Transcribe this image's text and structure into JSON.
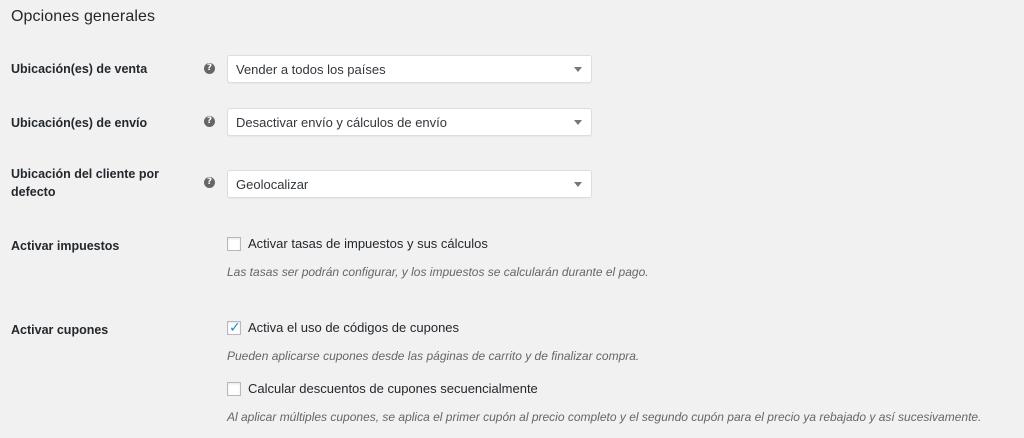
{
  "section": {
    "title": "Opciones generales"
  },
  "selling_locations": {
    "label": "Ubicación(es) de venta",
    "value": "Vender a todos los países"
  },
  "shipping_locations": {
    "label": "Ubicación(es) de envío",
    "value": "Desactivar envío y cálculos de envío"
  },
  "default_customer_location": {
    "label": "Ubicación del cliente por defecto",
    "value": "Geolocalizar"
  },
  "enable_taxes": {
    "label": "Activar impuestos",
    "checkbox_label": "Activar tasas de impuestos y sus cálculos",
    "checked": false,
    "description": "Las tasas ser podrán configurar, y los impuestos se calcularán durante el pago."
  },
  "enable_coupons": {
    "label": "Activar cupones",
    "checkbox_label": "Activa el uso de códigos de cupones",
    "checked": true,
    "description": "Pueden aplicarse cupones desde las páginas de carrito y de finalizar compra.",
    "sequential": {
      "checkbox_label": "Calcular descuentos de cupones secuencialmente",
      "checked": false,
      "description": "Al aplicar múltiples cupones, se aplica el primer cupón al precio completo y el segundo cupón para el precio ya rebajado y así sucesivamente."
    }
  },
  "icons": {
    "help": "help-icon",
    "dropdown": "chevron-down-icon",
    "check": "checkmark-icon"
  },
  "colors": {
    "background": "#f1f1f1",
    "checkmark": "#1e8cbe"
  }
}
